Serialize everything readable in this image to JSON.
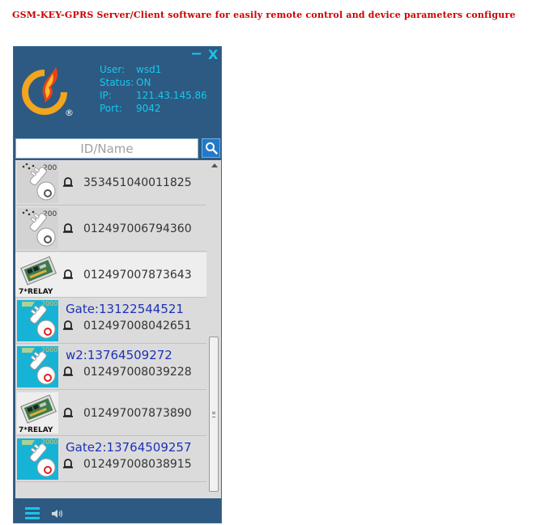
{
  "page": {
    "headline": "GSM-KEY-GPRS Server/Client software for easily remote control and device parameters configure"
  },
  "window": {
    "minimize_label": "−",
    "close_label": "X",
    "logo": {
      "icon": "flame-swirl-logo",
      "mark": "®"
    },
    "info": {
      "user_label": "User:",
      "user_value": "wsd1",
      "status_label": "Status:",
      "status_value": "ON",
      "ip_label": "IP:",
      "ip_value": "121.43.145.86",
      "port_label": "Port:",
      "port_value": "9042"
    },
    "search": {
      "placeholder": "ID/Name",
      "value": "",
      "button_icon": "search-icon"
    },
    "devices": [
      {
        "type": "key-200",
        "badge": "200",
        "name": "",
        "id": "353451040011825",
        "selected": false
      },
      {
        "type": "key-200",
        "badge": "200",
        "name": "",
        "id": "012497006794360",
        "selected": false
      },
      {
        "type": "relay-board",
        "badge": "7*RELAY",
        "name": "",
        "id": "012497007873643",
        "selected": true
      },
      {
        "type": "key-2000",
        "badge": "2000",
        "name": "Gate:13122544521",
        "id": "012497008042651",
        "selected": false
      },
      {
        "type": "key-2000",
        "badge": "2000",
        "name": "w2:13764509272",
        "id": "012497008039228",
        "selected": false
      },
      {
        "type": "relay-board",
        "badge": "7*RELAY",
        "name": "",
        "id": "012497007873890",
        "selected": false
      },
      {
        "type": "key-2000",
        "badge": "2000",
        "name": "Gate2:13764509257",
        "id": "012497008038915",
        "selected": false
      }
    ],
    "footer": {
      "menu_icon": "menu-icon",
      "sound_icon": "speaker-icon"
    }
  },
  "colors": {
    "headline": "#cc0000",
    "panel": "#2d5a82",
    "info_text": "#16c8ee",
    "list_bg": "#dcdbdb",
    "name_text": "#1c31b8",
    "search_button": "#2478c8"
  }
}
